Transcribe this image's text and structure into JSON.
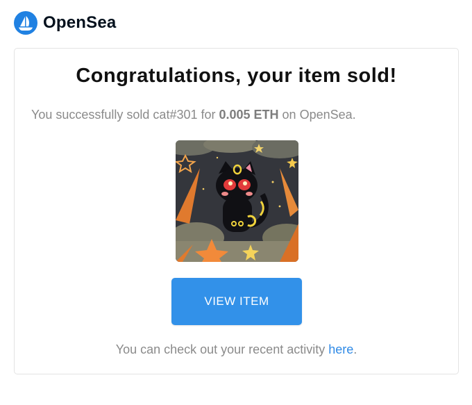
{
  "brand": {
    "name": "OpenSea",
    "logo_icon": "opensea-sailboat-icon",
    "logo_color": "#2081e2"
  },
  "email": {
    "title": "Congratulations, your item sold!",
    "message_prefix": "You successfully sold cat#301 for ",
    "price": "0.005 ETH",
    "message_suffix": " on OpenSea.",
    "item_image_icon": "black-cat-nft-artwork",
    "button_label": "VIEW ITEM",
    "button_color": "#3291e9",
    "footer_prefix": "You can check out your recent activity ",
    "footer_link": "here",
    "footer_suffix": ".",
    "link_color": "#2f8ae6"
  }
}
